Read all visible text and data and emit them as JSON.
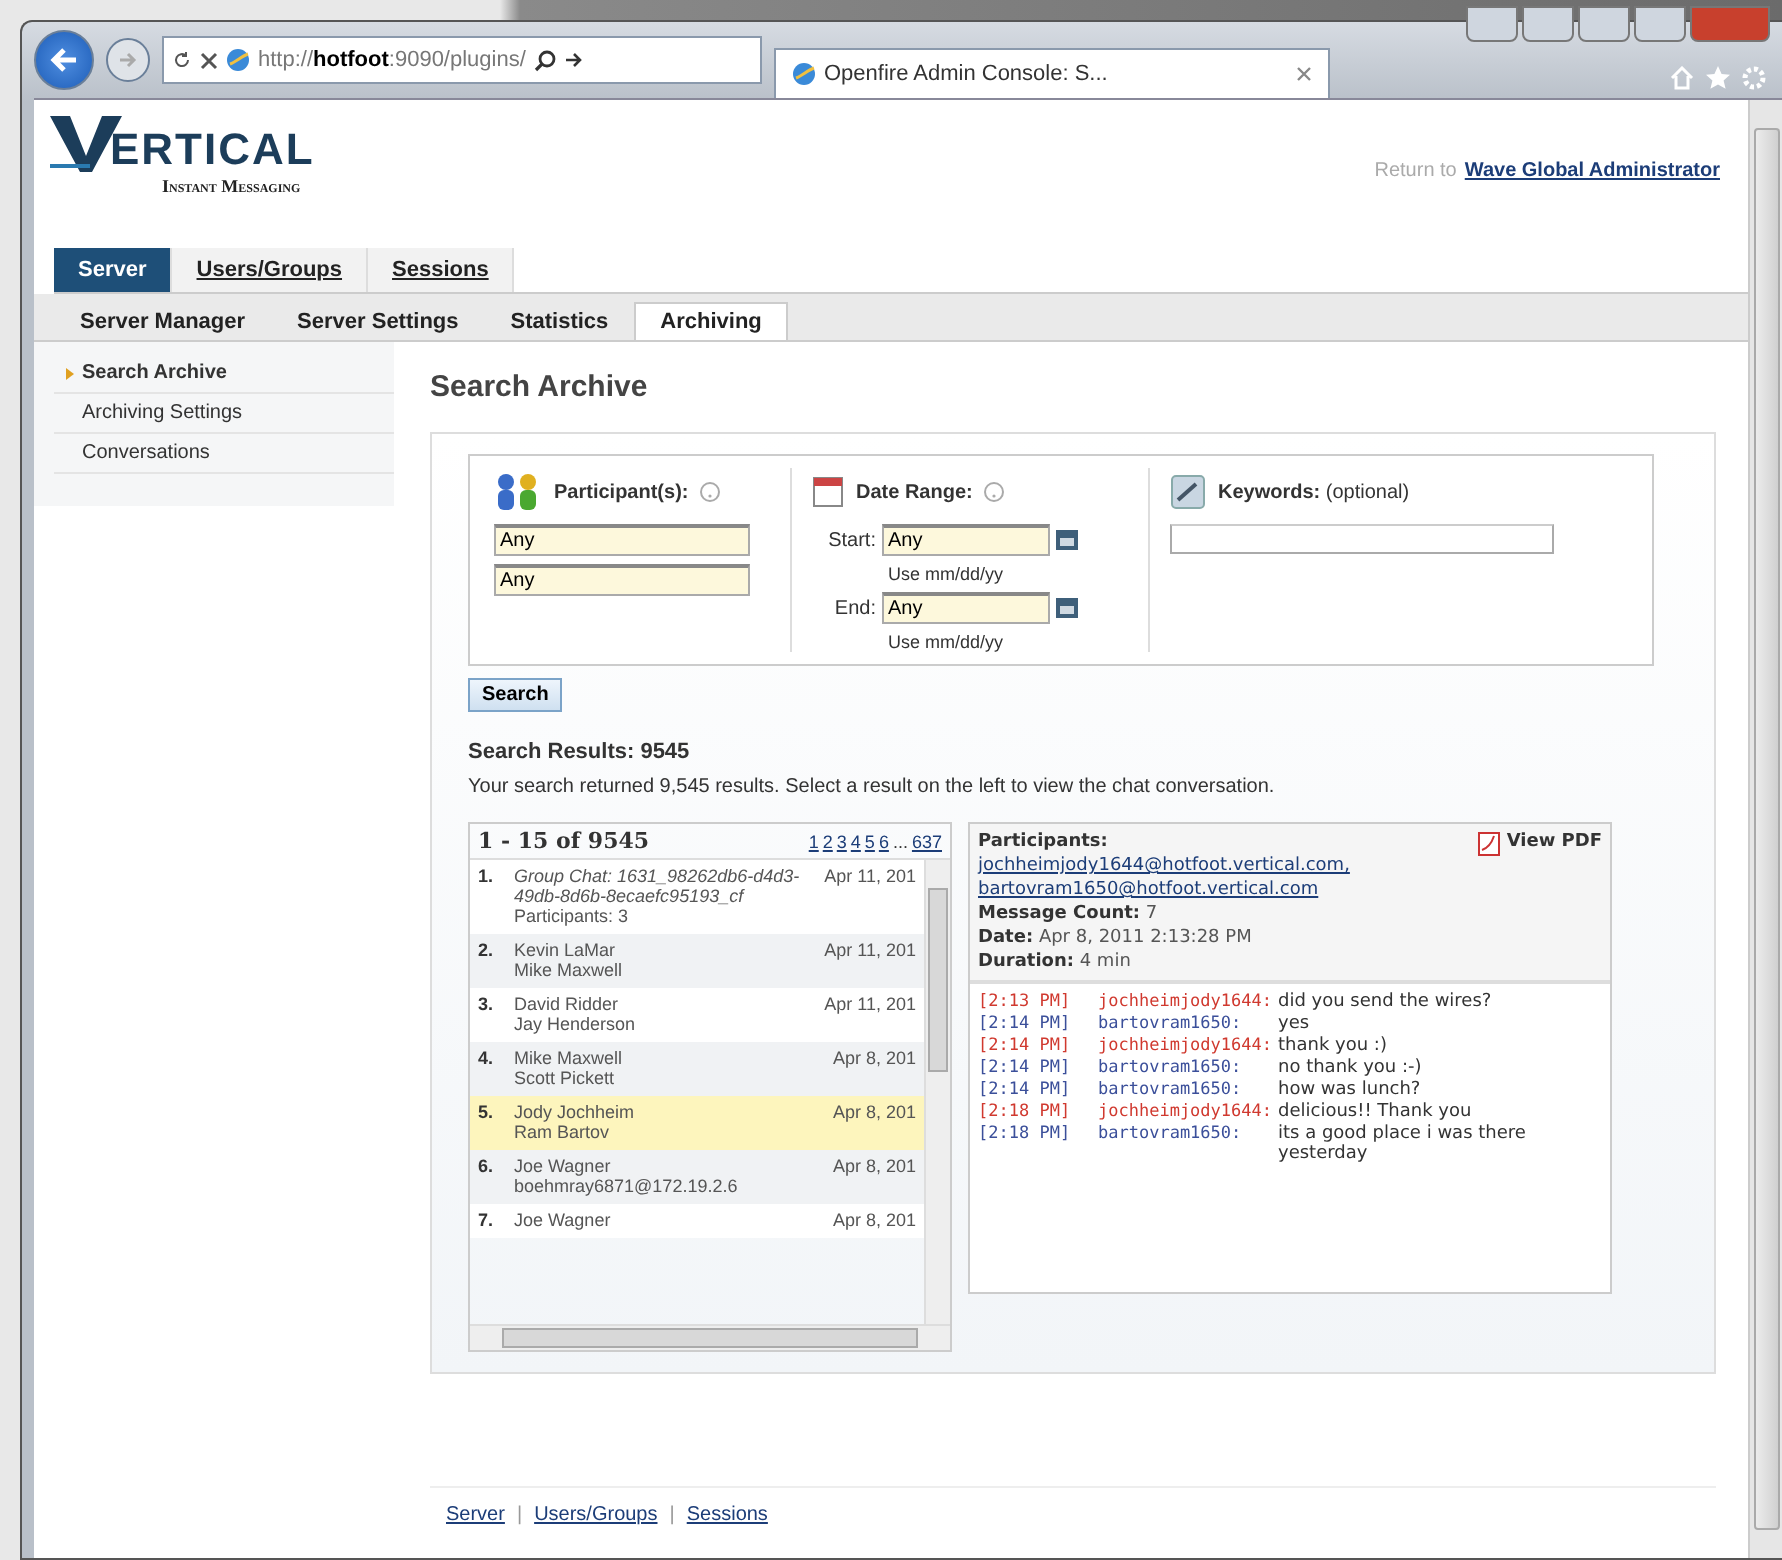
{
  "browser": {
    "address_prefix": "http://",
    "address_host": "hotfoot",
    "address_rest": ":9090/plugins/",
    "tab_title": "Openfire Admin Console: S..."
  },
  "header": {
    "logo_text": "ERTICAL",
    "logo_subtitle": "Instant Messaging",
    "return_label": "Return to",
    "return_link": "Wave Global Administrator"
  },
  "main_tabs": [
    {
      "label": "Server",
      "selected": true
    },
    {
      "label": "Users/Groups",
      "selected": false
    },
    {
      "label": "Sessions",
      "selected": false
    }
  ],
  "sub_tabs": [
    {
      "label": "Server Manager",
      "selected": false
    },
    {
      "label": "Server Settings",
      "selected": false
    },
    {
      "label": "Statistics",
      "selected": false
    },
    {
      "label": "Archiving",
      "selected": true
    }
  ],
  "sidebar": {
    "items": [
      {
        "label": "Search Archive",
        "selected": true
      },
      {
        "label": "Archiving Settings",
        "selected": false
      },
      {
        "label": "Conversations",
        "selected": false
      }
    ]
  },
  "page_title": "Search Archive",
  "form": {
    "participants_label": "Participant(s):",
    "participants": [
      "Any",
      "Any"
    ],
    "date_label": "Date Range:",
    "start_label": "Start:",
    "start_value": "Any",
    "end_label": "End:",
    "end_value": "Any",
    "date_hints": [
      "Use mm/dd/yy",
      "Use mm/dd/yy"
    ],
    "keywords_label": "Keywords:",
    "keywords_note": "(optional)",
    "search_button": "Search"
  },
  "results": {
    "title": "Search Results: 9545",
    "description": "Your search returned 9,545 results. Select a result on the left to view the chat conversation.",
    "range": "1 - 15 of 9545",
    "pages": [
      "1",
      "2",
      "3",
      "4",
      "5",
      "6"
    ],
    "ellipsis": "...",
    "last_page": "637",
    "rows": [
      {
        "number": "1.",
        "kind": "group",
        "lines": [
          "Group Chat: 1631_98262db6-d4d3-49db-8d6b-8ecaefc95193_cf"
        ],
        "extra": "Participants: 3",
        "date": "Apr 11, 201",
        "selected": false
      },
      {
        "number": "2.",
        "kind": "pair",
        "lines": [
          "Kevin LaMar",
          "Mike Maxwell"
        ],
        "date": "Apr 11, 201",
        "selected": false
      },
      {
        "number": "3.",
        "kind": "pair",
        "lines": [
          "David Ridder",
          "Jay Henderson"
        ],
        "date": "Apr 11, 201",
        "selected": false
      },
      {
        "number": "4.",
        "kind": "pair",
        "lines": [
          "Mike Maxwell",
          "Scott Pickett"
        ],
        "date": "Apr 8, 201",
        "selected": false
      },
      {
        "number": "5.",
        "kind": "pair",
        "lines": [
          "Jody Jochheim",
          "Ram Bartov"
        ],
        "date": "Apr 8, 201",
        "selected": true
      },
      {
        "number": "6.",
        "kind": "pair",
        "lines": [
          "Joe Wagner",
          "boehmray6871@172.19.2.6"
        ],
        "date": "Apr 8, 201",
        "selected": false
      },
      {
        "number": "7.",
        "kind": "pair",
        "lines": [
          "Joe Wagner"
        ],
        "date": "Apr 8, 201",
        "selected": false
      }
    ]
  },
  "conversation": {
    "participants_label": "Participants:",
    "participants": [
      "jochheimjody1644@hotfoot.vertical.com,",
      "bartovram1650@hotfoot.vertical.com"
    ],
    "view_pdf": "View PDF",
    "count_label": "Message Count:",
    "count": "7",
    "date_label": "Date:",
    "date": "Apr 8, 2011 2:13:28 PM",
    "duration_label": "Duration:",
    "duration": "4 min",
    "messages": [
      {
        "time": "[2:13 PM]",
        "sender": "jochheimjody1644:",
        "text": "did you send the wires?",
        "color": "#d0392f"
      },
      {
        "time": "[2:14 PM]",
        "sender": "bartovram1650:",
        "text": "yes",
        "color": "#3b4f9a"
      },
      {
        "time": "[2:14 PM]",
        "sender": "jochheimjody1644:",
        "text": "thank you :)",
        "color": "#d0392f"
      },
      {
        "time": "[2:14 PM]",
        "sender": "bartovram1650:",
        "text": "no thank you :-)",
        "color": "#3b4f9a"
      },
      {
        "time": "[2:14 PM]",
        "sender": "bartovram1650:",
        "text": "how was lunch?",
        "color": "#3b4f9a"
      },
      {
        "time": "[2:18 PM]",
        "sender": "jochheimjody1644:",
        "text": "delicious!! Thank you",
        "color": "#d0392f"
      },
      {
        "time": "[2:18 PM]",
        "sender": "bartovram1650:",
        "text": "its a good place i was there yesterday",
        "color": "#3b4f9a"
      }
    ]
  },
  "footer_links": [
    "Server",
    "Users/Groups",
    "Sessions"
  ],
  "footer_separator": "|"
}
